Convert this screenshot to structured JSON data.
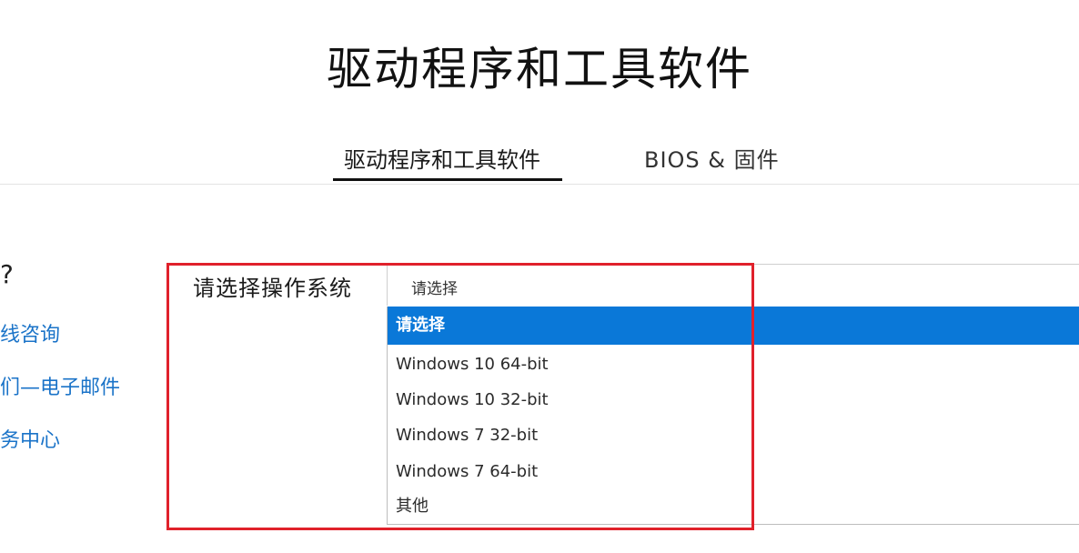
{
  "page": {
    "title": "驱动程序和工具软件"
  },
  "tabs": [
    {
      "label": "驱动程序和工具软件",
      "active": true
    },
    {
      "label": "BIOS & 固件",
      "active": false
    }
  ],
  "help": {
    "question_fragment": "?",
    "links": [
      "线咨询",
      "们—电子邮件",
      "务中心"
    ]
  },
  "os_select": {
    "label": "请选择操作系统",
    "value": "请选择",
    "options": [
      {
        "label": "请选择",
        "selected": true
      },
      {
        "label": "Windows 10 64-bit",
        "selected": false
      },
      {
        "label": "Windows 10 32-bit",
        "selected": false
      },
      {
        "label": "Windows 7 32-bit",
        "selected": false
      },
      {
        "label": "Windows 7 64-bit",
        "selected": false
      },
      {
        "label": "其他",
        "selected": false
      }
    ]
  },
  "colors": {
    "link": "#1a73c8",
    "selected_option_bg": "#0a78d8",
    "highlight_border": "#e0212b"
  }
}
